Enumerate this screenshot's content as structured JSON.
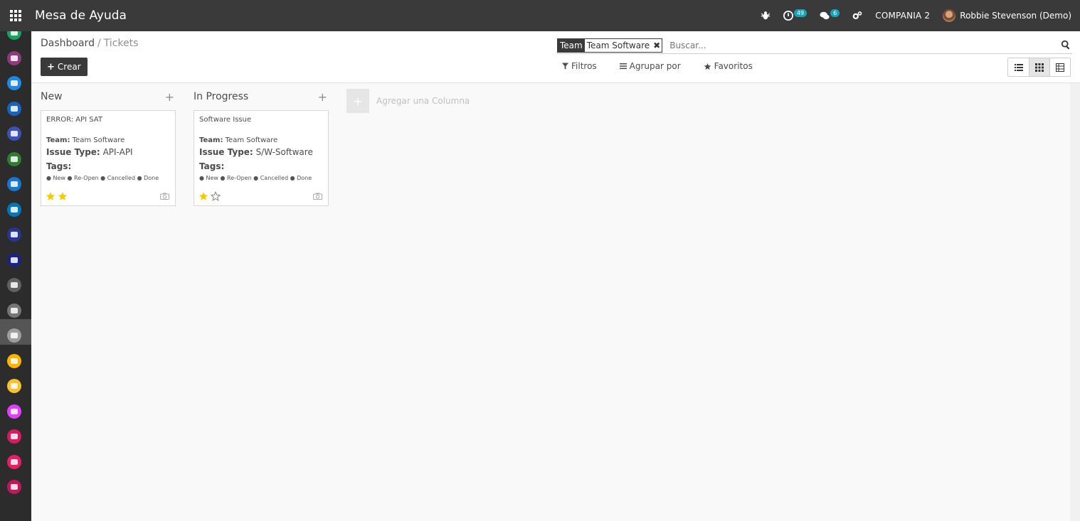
{
  "topbar": {
    "app_title": "Mesa de Ayuda",
    "activity_count": "49",
    "messages_count": "6",
    "company": "COMPANIA 2",
    "user": "Robbie Stevenson (Demo)"
  },
  "breadcrumb": {
    "parent": "Dashboard",
    "separator": "/",
    "current": "Tickets"
  },
  "create_label": "Crear",
  "search": {
    "facet_label": "Team",
    "facet_value": "Team Software",
    "placeholder": "Buscar..."
  },
  "search_options": {
    "filters": "Filtros",
    "group_by": "Agrupar por",
    "favorites": "Favoritos"
  },
  "columns": [
    {
      "title": "New",
      "card": {
        "title": "ERROR: API SAT",
        "team_label": "Team:",
        "team_value": "Team Software",
        "issue_label": "Issue Type:",
        "issue_value": "API-API",
        "tags_label": "Tags:",
        "tags": "● New ● Re-Open ● Cancelled ● Done",
        "priority_stars": 2
      }
    },
    {
      "title": "In Progress",
      "card": {
        "title": "Software Issue",
        "team_label": "Team:",
        "team_value": "Team Software",
        "issue_label": "Issue Type:",
        "issue_value": "S/W-Software",
        "tags_label": "Tags:",
        "tags": "● New ● Re-Open ● Cancelled ● Done",
        "priority_stars": 1
      }
    }
  ],
  "add_column_label": "Agregar una Columna",
  "colors": {
    "topbar": "#3a3a3a",
    "sidebar": "#2c2c2c",
    "badge": "#17a2b8",
    "star": "#f3cc00"
  },
  "sidebar_icons": [
    "#1aa260",
    "#8e3b7a",
    "#1e88e5",
    "#1565c0",
    "#3f51b5",
    "#2e7d32",
    "#1976d2",
    "#0277bd",
    "#283593",
    "#1a237e",
    "#616161",
    "#757575",
    "#9e9e9e",
    "#ffb300",
    "#fbc02d",
    "#e040fb",
    "#d81b60",
    "#e91e63",
    "#c2185b"
  ]
}
